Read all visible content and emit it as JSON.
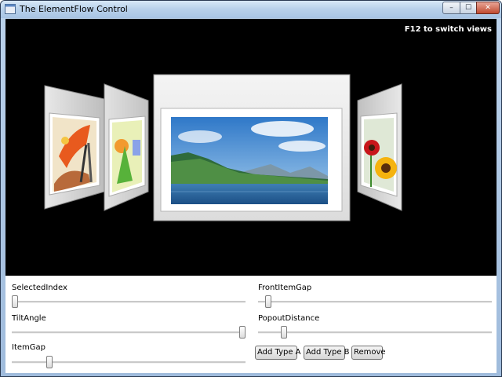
{
  "window": {
    "title": "The ElementFlow Control",
    "min_glyph": "–",
    "max_glyph": "☐",
    "close_glyph": "✕"
  },
  "stage": {
    "hint": "F12 to switch views",
    "background": "#000000"
  },
  "controls": {
    "sliders": [
      {
        "id": "selected-index",
        "label": "SelectedIndex",
        "value": 0.0
      },
      {
        "id": "front-item-gap",
        "label": "FrontItemGap",
        "value": 0.03
      },
      {
        "id": "tilt-angle",
        "label": "TiltAngle",
        "value": 1.0
      },
      {
        "id": "popout-distance",
        "label": "PopoutDistance",
        "value": 0.1
      },
      {
        "id": "item-gap",
        "label": "ItemGap",
        "value": 0.15
      }
    ],
    "buttons": {
      "add_a": "Add Type A",
      "add_b": "Add Type B",
      "remove": "Remove"
    }
  }
}
